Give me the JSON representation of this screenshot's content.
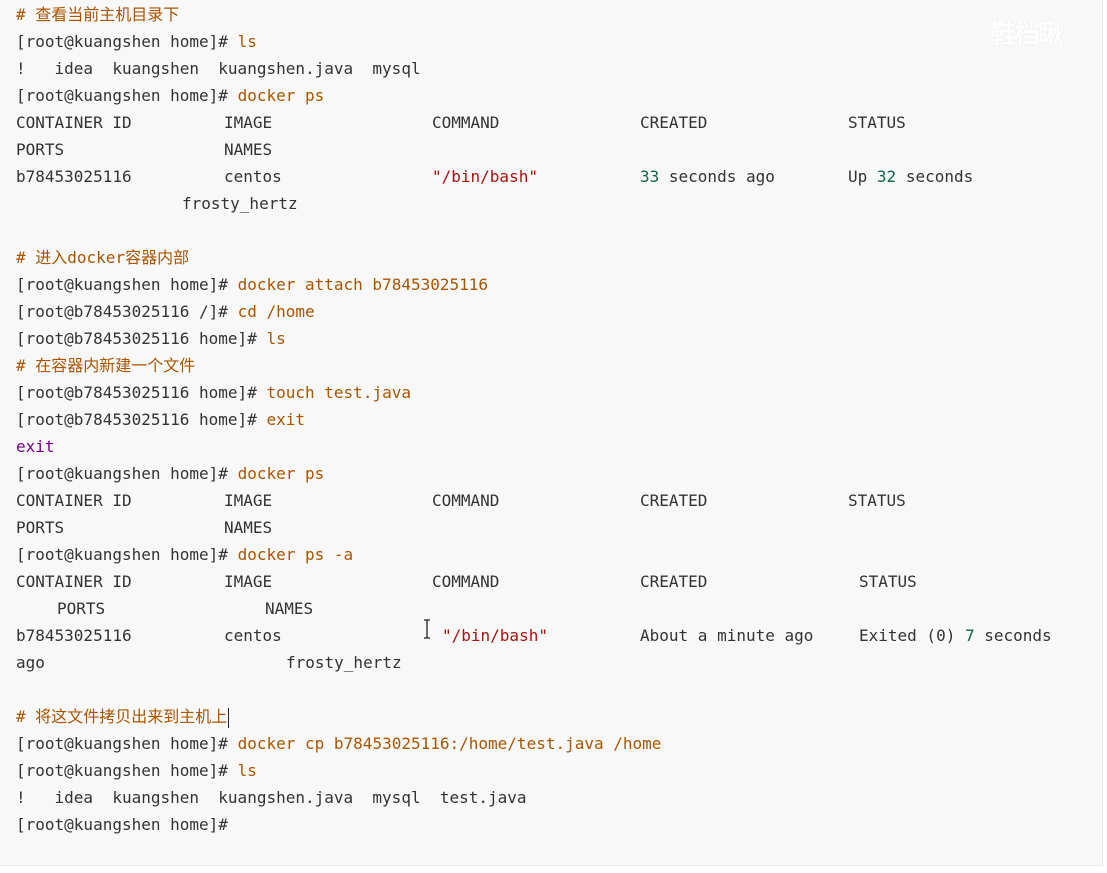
{
  "terminal": {
    "comments": {
      "view_host_dir": "# 查看当前主机目录下",
      "enter_container": "# 进入docker容器内部",
      "new_file": "# 在容器内新建一个文件",
      "copy_out": "# 将这文件拷贝出来到主机上"
    },
    "prompts": {
      "host_home": "[root@kuangshen home]#",
      "container_root": "[root@b78453025116 /]#",
      "container_home": "[root@b78453025116 home]#"
    },
    "commands": {
      "ls": "ls",
      "docker_ps": "docker ps",
      "docker_attach": "docker attach b78453025116",
      "cd_home": "cd /home",
      "touch_prefix": "touch",
      "touch_file": "test.java",
      "exit": "exit",
      "docker_ps_a_cmd": "docker ps",
      "docker_ps_a_flag": "-a",
      "docker_cp_prefix": "docker cp",
      "docker_cp_src": "b78453025116:/home/test.java",
      "docker_cp_dst": "/home"
    },
    "output": {
      "ls_before": "!   idea  kuangshen  kuangshen.java  mysql",
      "ls_after": "!   idea  kuangshen  kuangshen.java  mysql  test.java",
      "exit_echo": "exit"
    },
    "ps_headers": {
      "container_id": "CONTAINER ID",
      "image": "IMAGE",
      "command": "COMMAND",
      "created": "CREATED",
      "status": "STATUS",
      "ports": "PORTS",
      "names": "NAMES"
    },
    "ps_running_row": {
      "container_id": "b78453025116",
      "image": "centos",
      "command": "\"/bin/bash\"",
      "created": "33 seconds ago",
      "status_prefix": "Up",
      "status_num": "32",
      "status_suffix": "seconds",
      "names": "frosty_hertz"
    },
    "ps_exited_row": {
      "container_id": "b78453025116",
      "image": "centos",
      "command": "\"/bin/bash\"",
      "created": "About a minute ago",
      "status_prefix": "Exited (0)",
      "status_num": "7",
      "status_suffix": "seconds",
      "wrap": "ago",
      "names": "frosty_hertz"
    }
  },
  "watermark": "鞋档瞅",
  "colors": {
    "comment": "#aa5500",
    "command": "#aa5500",
    "keyword": "#770088",
    "string": "#aa1111",
    "number": "#116644",
    "text": "#333333",
    "panel_bg": "#f8f8f8"
  },
  "icons": {
    "cursor": "text-cursor-ibeam-icon"
  }
}
